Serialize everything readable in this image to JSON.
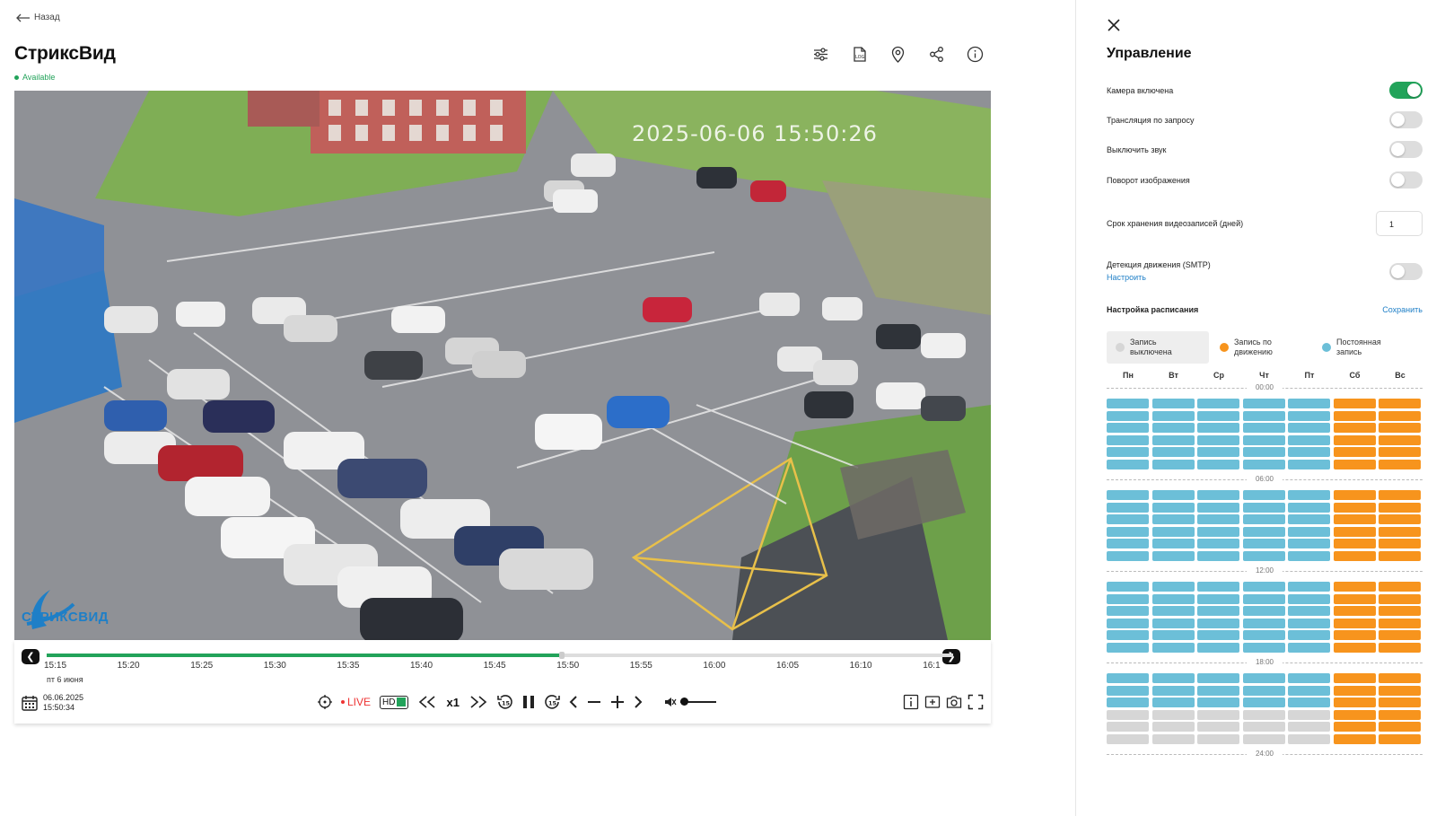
{
  "header": {
    "back_label": "Назад",
    "title": "СтриксВид",
    "status": "Available",
    "status_color": "#22a35a",
    "icons": [
      "sliders-icon",
      "log-icon",
      "map-pin-icon",
      "share-icon",
      "info-icon"
    ]
  },
  "video": {
    "timestamp": "2025-06-06 15:50:26",
    "watermark": "СТРИКСВИД"
  },
  "timeline": {
    "progress": 0.568,
    "ticks": [
      "15:15",
      "15:20",
      "15:25",
      "15:30",
      "15:35",
      "15:40",
      "15:45",
      "15:50",
      "15:55",
      "16:00",
      "16:05",
      "16:10",
      "16:1"
    ],
    "day_label": "пт 6 июня",
    "date": "06.06.2025",
    "time": "15:50:34",
    "live_label": "LIVE",
    "hd_label": "HD",
    "speed_label": "x1",
    "volume": 0.0
  },
  "panel": {
    "title": "Управление",
    "settings": [
      {
        "label": "Камера включена",
        "on": true
      },
      {
        "label": "Трансляция по запросу",
        "on": false
      },
      {
        "label": "Выключить звук",
        "on": false
      },
      {
        "label": "Поворот изображения",
        "on": false
      }
    ],
    "retention_label": "Срок хранения видеозаписей (дней)",
    "retention_value": "1",
    "motion_label": "Детекция движения (SMTP)",
    "motion_on": false,
    "configure_link": "Настроить",
    "schedule_title": "Настройка расписания",
    "save_label": "Сохранить",
    "legend": [
      {
        "label_1": "Запись",
        "label_2": "выключена",
        "color": "#d6d6d6",
        "selected": true
      },
      {
        "label_1": "Запись по",
        "label_2": "движению",
        "color": "#f7941d",
        "selected": false
      },
      {
        "label_1": "Постоянная",
        "label_2": "запись",
        "color": "#6cbfd8",
        "selected": false
      }
    ],
    "days": [
      "Пн",
      "Вт",
      "Ср",
      "Чт",
      "Пт",
      "Сб",
      "Вс"
    ],
    "hour_labels": [
      "00:00",
      "06:00",
      "12:00",
      "18:00",
      "24:00"
    ],
    "colors": {
      "off": "#d6d6d6",
      "motion": "#f7941d",
      "continuous": "#6cbfd8"
    }
  }
}
